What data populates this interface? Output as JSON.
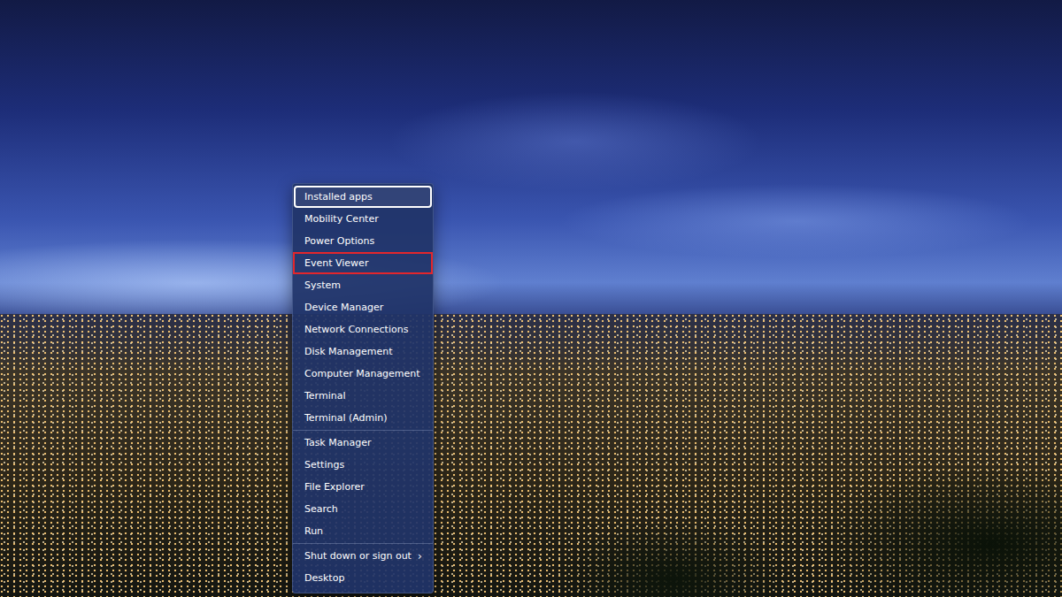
{
  "wallpaper": {
    "kind": "photo"
  },
  "menu": {
    "groups": [
      {
        "items": [
          {
            "label": "Installed apps",
            "focused": true,
            "highlighted": false
          },
          {
            "label": "Mobility Center",
            "focused": false,
            "highlighted": false
          },
          {
            "label": "Power Options",
            "focused": false,
            "highlighted": false
          },
          {
            "label": "Event Viewer",
            "focused": false,
            "highlighted": true
          },
          {
            "label": "System",
            "focused": false,
            "highlighted": false
          },
          {
            "label": "Device Manager",
            "focused": false,
            "highlighted": false
          },
          {
            "label": "Network Connections",
            "focused": false,
            "highlighted": false
          },
          {
            "label": "Disk Management",
            "focused": false,
            "highlighted": false
          },
          {
            "label": "Computer Management",
            "focused": false,
            "highlighted": false
          },
          {
            "label": "Terminal",
            "focused": false,
            "highlighted": false
          },
          {
            "label": "Terminal (Admin)",
            "focused": false,
            "highlighted": false
          }
        ]
      },
      {
        "items": [
          {
            "label": "Task Manager",
            "focused": false,
            "highlighted": false
          },
          {
            "label": "Settings",
            "focused": false,
            "highlighted": false
          },
          {
            "label": "File Explorer",
            "focused": false,
            "highlighted": false
          },
          {
            "label": "Search",
            "focused": false,
            "highlighted": false
          },
          {
            "label": "Run",
            "focused": false,
            "highlighted": false
          }
        ]
      },
      {
        "items": [
          {
            "label": "Shut down or sign out",
            "focused": false,
            "highlighted": false,
            "arrow": "›"
          },
          {
            "label": "Desktop",
            "focused": false,
            "highlighted": false
          }
        ]
      }
    ]
  }
}
